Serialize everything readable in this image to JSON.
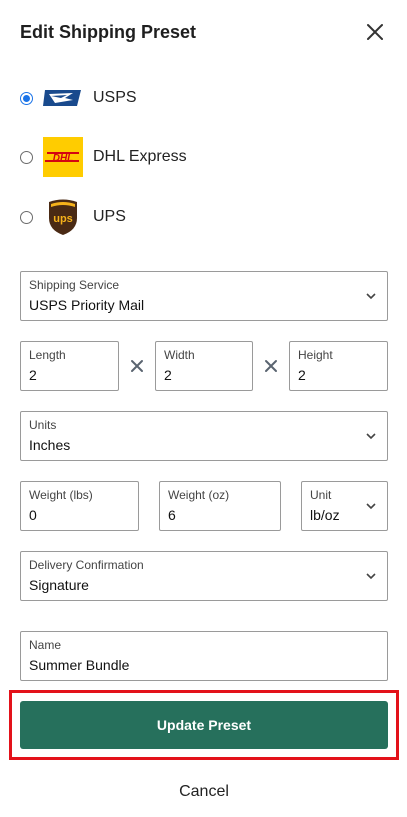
{
  "dialog": {
    "title": "Edit Shipping Preset",
    "close_icon": "close-icon"
  },
  "carriers": [
    {
      "label": "USPS",
      "selected": true,
      "logo_icon": "usps-eagle-logo",
      "logo_text": ""
    },
    {
      "label": "DHL Express",
      "selected": false,
      "logo_icon": "dhl-logo",
      "logo_text": "DHL"
    },
    {
      "label": "UPS",
      "selected": false,
      "logo_icon": "ups-shield-logo",
      "logo_text": "ups"
    }
  ],
  "form": {
    "shipping_service": {
      "label": "Shipping Service",
      "value": "USPS Priority Mail"
    },
    "length": {
      "label": "Length",
      "value": "2"
    },
    "width": {
      "label": "Width",
      "value": "2"
    },
    "height": {
      "label": "Height",
      "value": "2"
    },
    "units": {
      "label": "Units",
      "value": "Inches"
    },
    "weight_lbs": {
      "label": "Weight (lbs)",
      "value": "0"
    },
    "weight_oz": {
      "label": "Weight (oz)",
      "value": "6"
    },
    "weight_unit": {
      "label": "Unit",
      "value": "lb/oz"
    },
    "delivery_confirmation": {
      "label": "Delivery Confirmation",
      "value": "Signature"
    },
    "name": {
      "label": "Name",
      "value": "Summer Bundle"
    }
  },
  "actions": {
    "update_label": "Update Preset",
    "cancel_label": "Cancel"
  },
  "colors": {
    "primary": "#26705c",
    "highlight": "#e3121a",
    "radio_selected": "#1a73e8",
    "dhl_yellow": "#ffcc00",
    "dhl_red": "#d40511",
    "ups_brown": "#4a2a14",
    "ups_gold": "#f6b21b",
    "usps_blue": "#194a8d"
  }
}
